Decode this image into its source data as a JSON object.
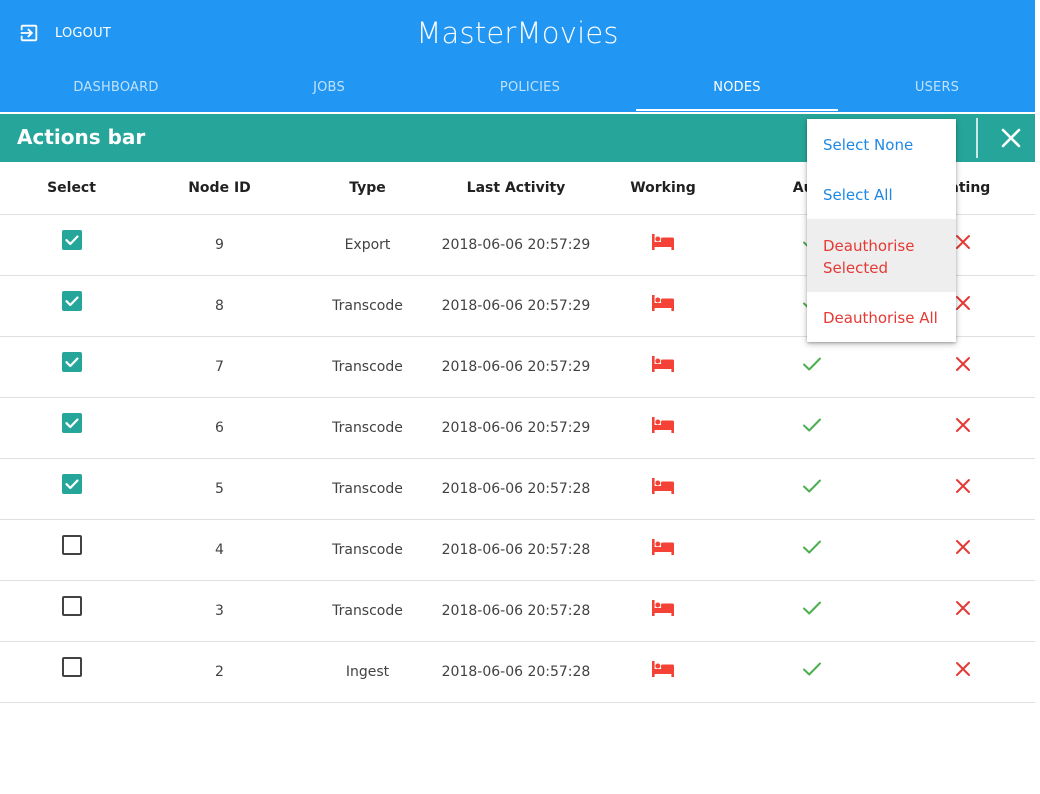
{
  "header": {
    "app_title": "MasterMovies",
    "logout_label": "LOGOUT",
    "logout_icon": "logout-icon",
    "tabs": [
      {
        "label": "DASHBOARD",
        "active": false
      },
      {
        "label": "JOBS",
        "active": false
      },
      {
        "label": "POLICIES",
        "active": false
      },
      {
        "label": "NODES",
        "active": true
      },
      {
        "label": "USERS",
        "active": false
      }
    ],
    "color": "#2196f3"
  },
  "actions_bar": {
    "title": "Actions bar",
    "close_icon": "close-icon",
    "color": "#26a69a"
  },
  "menu": {
    "items": [
      {
        "label": "Select None",
        "color": "#1e88e5"
      },
      {
        "label": "Select All",
        "color": "#1e88e5"
      },
      {
        "label": "Deauthorise Selected",
        "color": "#e53935",
        "highlighted": true
      },
      {
        "label": "Deauthorise All",
        "color": "#e53935"
      }
    ]
  },
  "table": {
    "columns": [
      "Select",
      "Node ID",
      "Type",
      "Last Activity",
      "Working",
      "Authorised",
      "Terminating"
    ],
    "visible_headers": [
      "Select",
      "Node ID",
      "Type",
      "Last Activity",
      "Working",
      "Auth",
      "inating"
    ],
    "rows": [
      {
        "checked": true,
        "node_id": "9",
        "type": "Export",
        "last_activity": "2018-06-06 20:57:29",
        "working_icon": "bed-icon",
        "authorised_icon": "check-icon",
        "terminating_icon": "cross-icon"
      },
      {
        "checked": true,
        "node_id": "8",
        "type": "Transcode",
        "last_activity": "2018-06-06 20:57:29",
        "working_icon": "bed-icon",
        "authorised_icon": "check-icon",
        "terminating_icon": "cross-icon"
      },
      {
        "checked": true,
        "node_id": "7",
        "type": "Transcode",
        "last_activity": "2018-06-06 20:57:29",
        "working_icon": "bed-icon",
        "authorised_icon": "check-icon",
        "terminating_icon": "cross-icon"
      },
      {
        "checked": true,
        "node_id": "6",
        "type": "Transcode",
        "last_activity": "2018-06-06 20:57:29",
        "working_icon": "bed-icon",
        "authorised_icon": "check-icon",
        "terminating_icon": "cross-icon"
      },
      {
        "checked": true,
        "node_id": "5",
        "type": "Transcode",
        "last_activity": "2018-06-06 20:57:28",
        "working_icon": "bed-icon",
        "authorised_icon": "check-icon",
        "terminating_icon": "cross-icon"
      },
      {
        "checked": false,
        "node_id": "4",
        "type": "Transcode",
        "last_activity": "2018-06-06 20:57:28",
        "working_icon": "bed-icon",
        "authorised_icon": "check-icon",
        "terminating_icon": "cross-icon"
      },
      {
        "checked": false,
        "node_id": "3",
        "type": "Transcode",
        "last_activity": "2018-06-06 20:57:28",
        "working_icon": "bed-icon",
        "authorised_icon": "check-icon",
        "terminating_icon": "cross-icon"
      },
      {
        "checked": false,
        "node_id": "2",
        "type": "Ingest",
        "last_activity": "2018-06-06 20:57:28",
        "working_icon": "bed-icon",
        "authorised_icon": "check-icon",
        "terminating_icon": "cross-icon"
      }
    ]
  },
  "colors": {
    "checkbox_checked": "#26a69a",
    "working_icon": "#f44336",
    "check": "#4caf50",
    "cross": "#e53935"
  }
}
